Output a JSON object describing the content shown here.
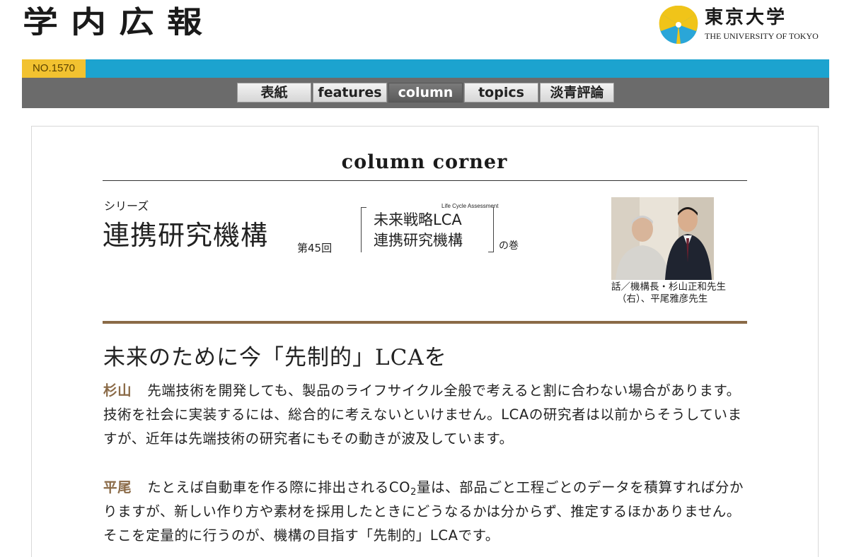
{
  "masthead": {
    "logo_text": "学内広報",
    "university_jp": "東京大学",
    "university_en": "THE UNIVERSITY OF TOKYO"
  },
  "issue": "NO.1570",
  "nav": [
    {
      "label": "表紙",
      "active": false
    },
    {
      "label": "features",
      "active": false
    },
    {
      "label": "column",
      "active": true
    },
    {
      "label": "topics",
      "active": false
    },
    {
      "label": "淡青評論",
      "active": false
    }
  ],
  "column": {
    "corner_title": "column corner",
    "series_label": "シリーズ",
    "org_name": "連携研究機構",
    "episode": "第45回",
    "lca_small": "Life Cycle Assessment",
    "lca_line1": "未来戦略LCA",
    "lca_line2": "連携研究機構",
    "no_maki": "の巻",
    "caption_line1": "話／機構長・杉山正和先生",
    "caption_line2": "（右）、平尾雅彦先生"
  },
  "article": {
    "headline": "未来のために今「先制的」LCAを",
    "p1_speaker": "杉山",
    "p1_text": "先端技術を開発しても、製品のライフサイクル全般で考えると割に合わない場合があります。技術を社会に実装するには、総合的に考えないといけません。LCAの研究者は以前からそうしていますが、近年は先端技術の研究者にもその動きが波及しています。",
    "p2_speaker": "平尾",
    "p2_text_a": "たとえば自動車を作る際に排出されるCO",
    "p2_sub": "2",
    "p2_text_b": "量は、部品ごと工程ごとのデータを積算すれば分かりますが、新しい作り方や素材を採用したときにどうなるかは分からず、推定するほかありません。そこを定量的に行うのが、機構の目指す「先制的」LCAです。"
  },
  "colors": {
    "bluebar": "#1ca3cf",
    "issue_bg": "#f2c230",
    "navbar": "#6b6b6b",
    "accent_brown": "#8a6a47"
  }
}
